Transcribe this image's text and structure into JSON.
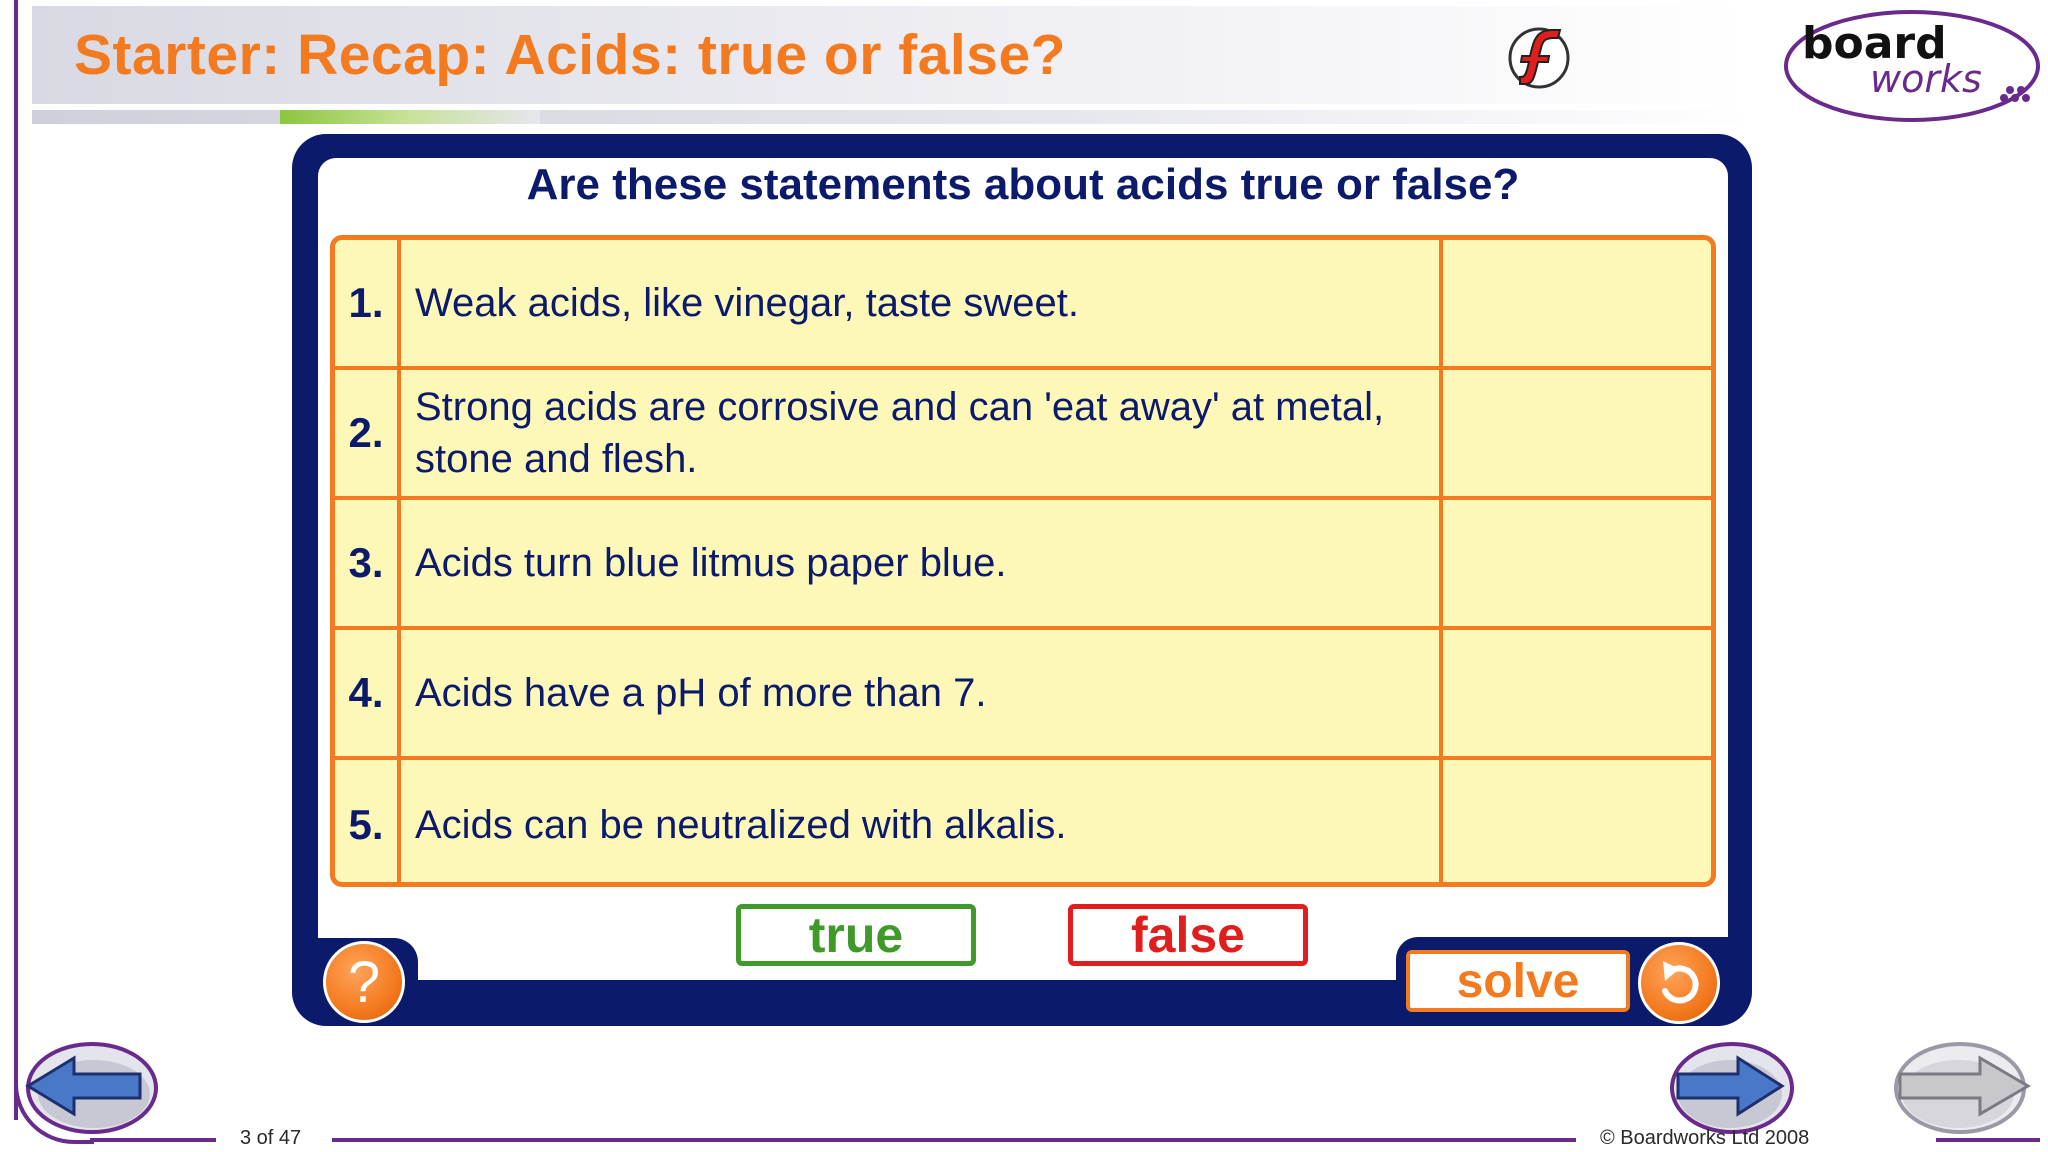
{
  "header": {
    "title": "Starter: Recap: Acids: true or false?",
    "logo_top": "board",
    "logo_bottom": "works"
  },
  "activity": {
    "question": "Are these statements about acids true or false?",
    "statements": [
      {
        "number": "1.",
        "text": "Weak acids, like vinegar, taste sweet.",
        "answer": ""
      },
      {
        "number": "2.",
        "text": "Strong acids are corrosive and can 'eat away' at metal, stone and flesh.",
        "answer": ""
      },
      {
        "number": "3.",
        "text": "Acids turn blue litmus paper blue.",
        "answer": ""
      },
      {
        "number": "4.",
        "text": "Acids have a pH of more than 7.",
        "answer": ""
      },
      {
        "number": "5.",
        "text": "Acids can be neutralized with alkalis.",
        "answer": ""
      }
    ],
    "true_label": "true",
    "false_label": "false",
    "solve_label": "solve",
    "help_label": "?"
  },
  "footer": {
    "page": "3 of 47",
    "copyright": "© Boardworks Ltd 2008"
  },
  "colors": {
    "accent_orange": "#f47a20",
    "navy": "#0b1a6b",
    "frame_purple": "#6a2a8c",
    "true_green": "#3f9a2a",
    "false_red": "#e01e1e",
    "row_fill": "#fdf8b7"
  },
  "icons": {
    "flash": "flash-icon",
    "help": "question-mark-icon",
    "reset": "reset-arrow-icon",
    "prev": "arrow-left-icon",
    "next": "arrow-right-icon"
  }
}
